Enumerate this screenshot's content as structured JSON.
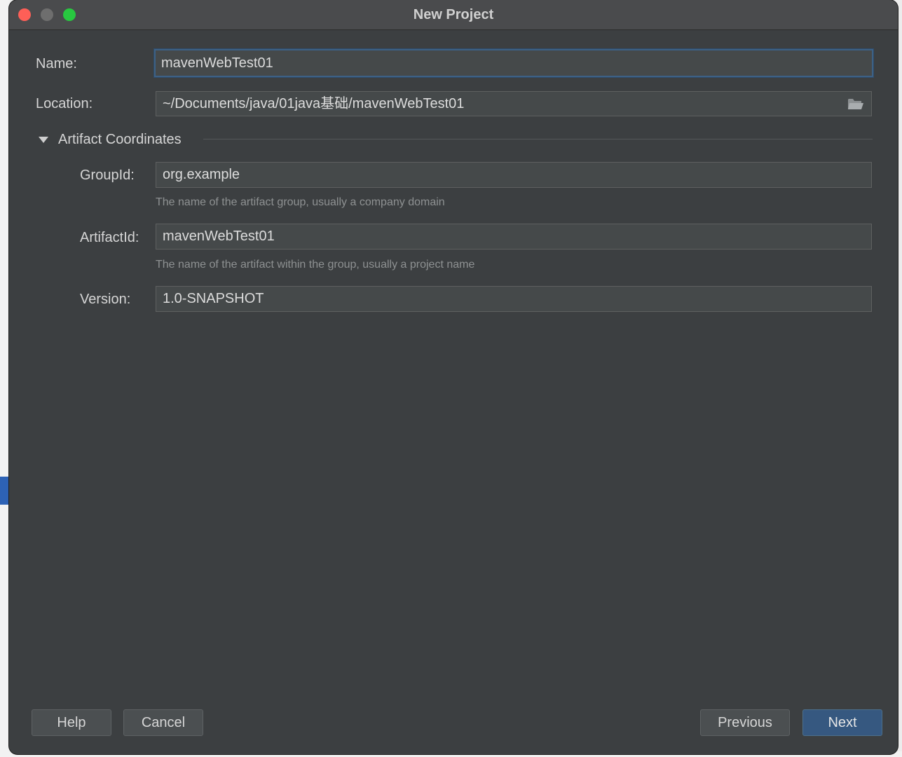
{
  "window": {
    "title": "New Project"
  },
  "form": {
    "name_label": "Name:",
    "name_value": "mavenWebTest01",
    "location_label": "Location:",
    "location_value": "~/Documents/java/01java基础/mavenWebTest01",
    "section_title": "Artifact Coordinates",
    "groupid_label": "GroupId:",
    "groupid_value": "org.example",
    "groupid_hint": "The name of the artifact group, usually a company domain",
    "artifactid_label": "ArtifactId:",
    "artifactid_value": "mavenWebTest01",
    "artifactid_hint": "The name of the artifact within the group, usually a project name",
    "version_label": "Version:",
    "version_value": "1.0-SNAPSHOT"
  },
  "buttons": {
    "help": "Help",
    "cancel": "Cancel",
    "previous": "Previous",
    "next": "Next"
  },
  "icons": {
    "folder": "folder-icon",
    "expand": "triangle-down-icon"
  },
  "colors": {
    "dialog_bg": "#3c3f41",
    "field_bg": "#45494a",
    "focus_border": "#3d6185",
    "primary_button": "#365880"
  }
}
